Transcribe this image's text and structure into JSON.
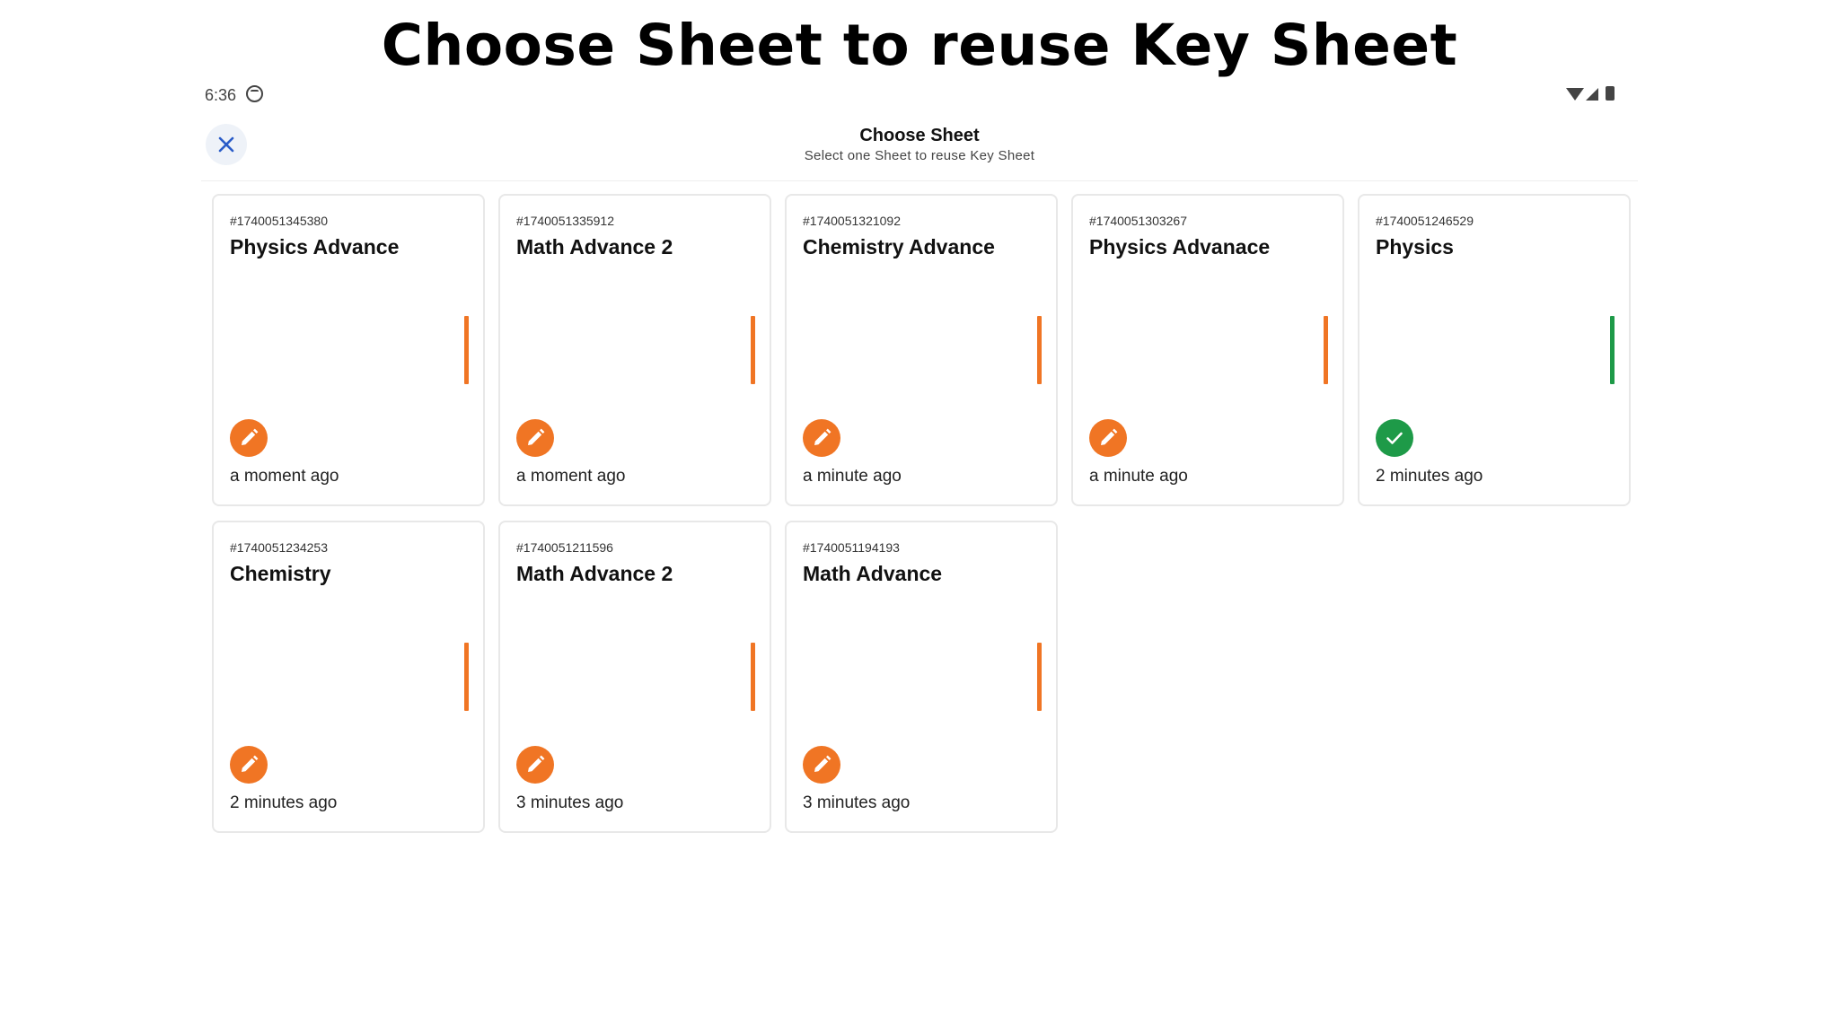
{
  "headline": "Choose Sheet to reuse Key Sheet",
  "status_bar": {
    "time": "6:36"
  },
  "header": {
    "title": "Choose Sheet",
    "subtitle": "Select one Sheet to reuse Key Sheet"
  },
  "colors": {
    "draft": "#f07524",
    "done": "#1e9a48",
    "close_icon": "#2a5cc8"
  },
  "sheets": [
    {
      "id": "#1740051345380",
      "title": "Physics Advance",
      "time": "a moment ago",
      "status": "edit-icon",
      "status_color": "#f07524"
    },
    {
      "id": "#1740051335912",
      "title": "Math Advance 2",
      "time": "a moment ago",
      "status": "edit-icon",
      "status_color": "#f07524"
    },
    {
      "id": "#1740051321092",
      "title": "Chemistry Advance",
      "time": "a minute ago",
      "status": "edit-icon",
      "status_color": "#f07524"
    },
    {
      "id": "#1740051303267",
      "title": "Physics Advanace",
      "time": "a minute ago",
      "status": "edit-icon",
      "status_color": "#f07524"
    },
    {
      "id": "#1740051246529",
      "title": "Physics",
      "time": "2 minutes ago",
      "status": "check-icon",
      "status_color": "#1e9a48"
    },
    {
      "id": "#1740051234253",
      "title": "Chemistry",
      "time": "2 minutes ago",
      "status": "edit-icon",
      "status_color": "#f07524"
    },
    {
      "id": "#1740051211596",
      "title": "Math Advance 2",
      "time": "3 minutes ago",
      "status": "edit-icon",
      "status_color": "#f07524"
    },
    {
      "id": "#1740051194193",
      "title": "Math Advance",
      "time": "3 minutes ago",
      "status": "edit-icon",
      "status_color": "#f07524"
    }
  ]
}
